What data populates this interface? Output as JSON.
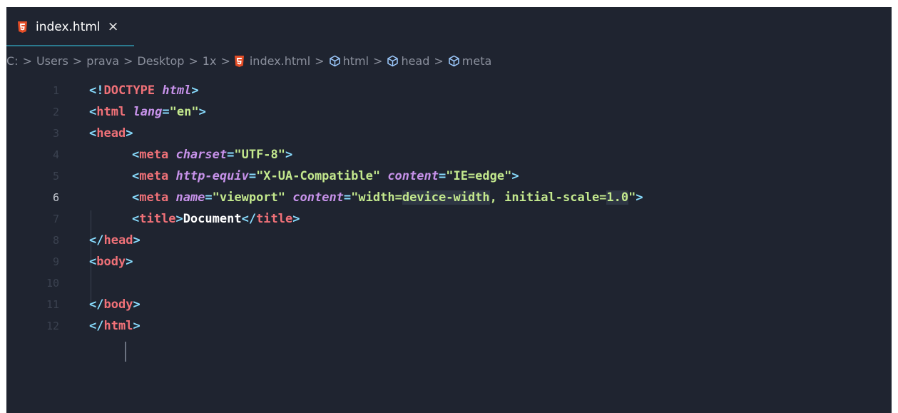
{
  "tab": {
    "title": "index.html",
    "close_glyph": "×",
    "icon": "html5-icon"
  },
  "breadcrumb": {
    "items": [
      "C:",
      "Users",
      "prava",
      "Desktop",
      "1x",
      "index.html",
      "html",
      "head",
      "meta"
    ],
    "separator": ">"
  },
  "editor": {
    "active_line": 6,
    "lines": [
      {
        "n": "1"
      },
      {
        "n": "2"
      },
      {
        "n": "3"
      },
      {
        "n": "4"
      },
      {
        "n": "5"
      },
      {
        "n": "6"
      },
      {
        "n": "7"
      },
      {
        "n": "8"
      },
      {
        "n": "9"
      },
      {
        "n": "10"
      },
      {
        "n": "11"
      },
      {
        "n": "12"
      }
    ],
    "tokens": {
      "l1": {
        "a": "<!",
        "b": "DOCTYPE",
        "c": " ",
        "d": "html",
        "e": ">"
      },
      "l2": {
        "a": "<",
        "b": "html",
        "c": " ",
        "d": "lang",
        "e": "=",
        "f": "\"en\"",
        "g": ">"
      },
      "l3": {
        "a": "<",
        "b": "head",
        "c": ">"
      },
      "l4": {
        "a": "<",
        "b": "meta",
        "c": " ",
        "d": "charset",
        "e": "=",
        "f": "\"UTF-8\"",
        "g": ">"
      },
      "l5": {
        "a": "<",
        "b": "meta",
        "c": " ",
        "d": "http-equiv",
        "e": "=",
        "f": "\"X-UA-Compatible\"",
        "g": " ",
        "h": "content",
        "i": "=",
        "j": "\"IE=edge\"",
        "k": ">"
      },
      "l6": {
        "a": "<",
        "b": "meta",
        "c": " ",
        "d": "name",
        "e": "=",
        "f": "\"viewport\"",
        "g": " ",
        "h": "content",
        "i": "=",
        "j1": "\"width=",
        "j2": "device-width",
        "j3": ", initial-scale=",
        "j4": "1.0",
        "j5": "\"",
        "k": ">"
      },
      "l7": {
        "a": "<",
        "b": "title",
        "c": ">",
        "d": "Document",
        "e": "</",
        "f": "title",
        "g": ">"
      },
      "l8": {
        "a": "</",
        "b": "head",
        "c": ">"
      },
      "l9": {
        "a": "<",
        "b": "body",
        "c": ">"
      },
      "l11": {
        "a": "</",
        "b": "body",
        "c": ">"
      },
      "l12": {
        "a": "</",
        "b": "html",
        "c": ">"
      }
    }
  },
  "colors": {
    "background": "#1f2430",
    "tag": "#f07178",
    "punct": "#89ddff",
    "attr": "#c792ea",
    "string": "#c3e88d",
    "html5_orange": "#e44d26"
  }
}
